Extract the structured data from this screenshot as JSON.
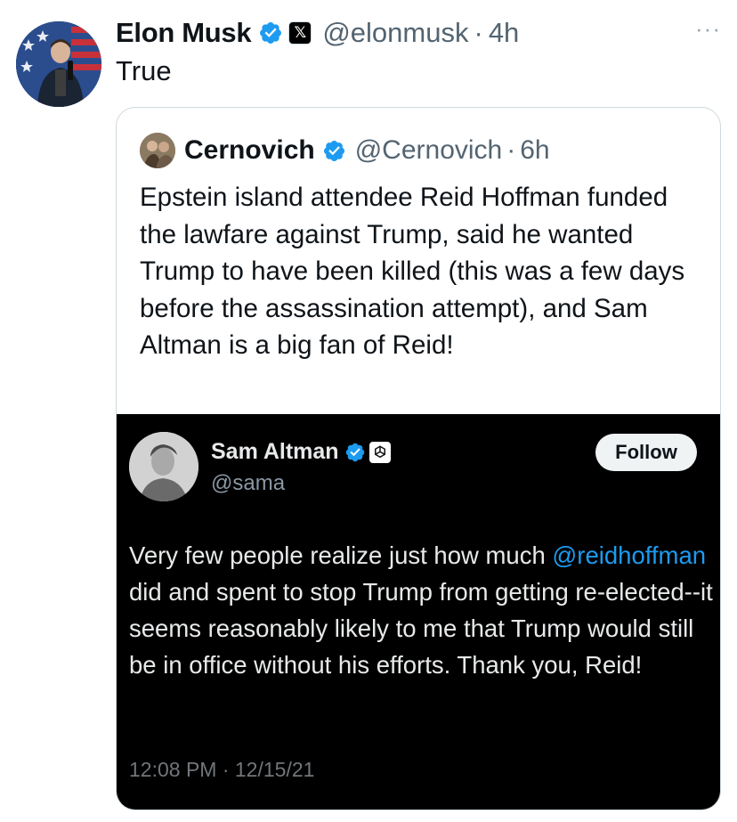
{
  "author": {
    "name": "Elon Musk",
    "handle": "@elonmusk",
    "separator": "·",
    "time": "4h",
    "verified_icon": "verified-badge-icon",
    "affiliation_icon": "x-logo-icon",
    "avatar_icon": "avatar"
  },
  "tweet": {
    "text": "True",
    "more_icon": "more-options-icon"
  },
  "quote": {
    "name": "Cernovich",
    "handle": "@Cernovich",
    "separator": "·",
    "time": "6h",
    "text": "Epstein island attendee Reid Hoffman funded the lawfare against Trump, said he wanted Trump to have been killed (this was a few days before the assassination attempt), and Sam Altman is a big fan of Reid!"
  },
  "embedded": {
    "name": "Sam Altman",
    "handle": "@sama",
    "follow_label": "Follow",
    "text_before": "Very few people realize just how much ",
    "mention": "@reidhoffman",
    "text_after": " did and spent to stop Trump from getting re-elected--it seems reasonably likely to me that Trump would still be in office without his efforts. Thank you, Reid!",
    "timestamp": "12:08 PM · 12/15/21",
    "affiliation_icon": "openai-logo-icon"
  },
  "colors": {
    "verified_blue": "#1d9bf0",
    "text_primary": "#0f1419",
    "text_secondary": "#536471",
    "card_border": "#cfd9de",
    "dark_bg": "#000000"
  }
}
